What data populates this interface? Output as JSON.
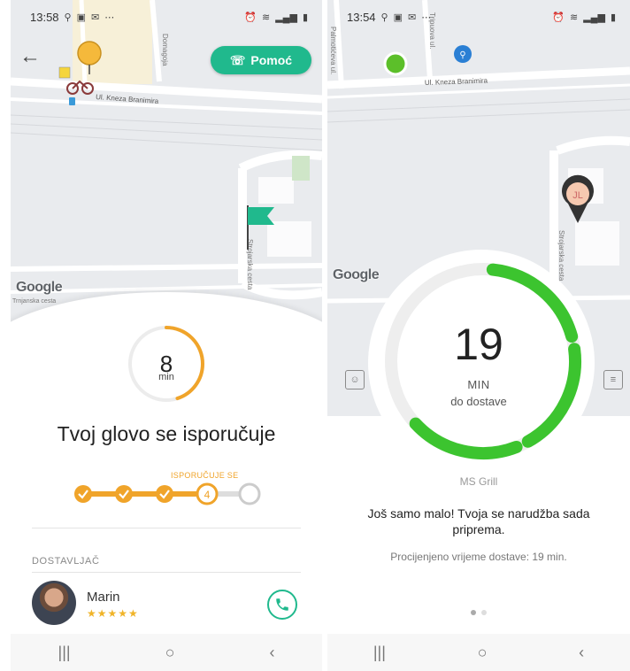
{
  "left_screen": {
    "status_bar": {
      "time": "13:58",
      "icons_left": [
        "location-icon",
        "image-icon",
        "mail-icon",
        "more-icon"
      ],
      "icons_right": [
        "alarm-icon",
        "wifi-icon",
        "call-icon",
        "signal-icon",
        "battery-icon"
      ]
    },
    "map": {
      "streets": [
        "Ul. Kneza Branimira",
        "Domagoja",
        "Strojarska cesta",
        "Trnjanska cesta"
      ],
      "google": "Google"
    },
    "help_button": {
      "label": "Pomoć",
      "icon": "chat-phone-icon"
    },
    "timer": {
      "value": "8",
      "unit": "min",
      "progress": 0.45,
      "color": "#f0a42a"
    },
    "status_title": "Tvoj glovo se isporučuje",
    "progress_steps": {
      "current_label": "ISPORUČUJE SE",
      "current_step": "4",
      "completed": 3,
      "total": 5
    },
    "courier_section": {
      "label": "DOSTAVLJAČ",
      "name": "Marin",
      "rating": "★★★★★"
    },
    "colors": {
      "accent": "#f0a42a",
      "brand": "#20b98d"
    }
  },
  "right_screen": {
    "status_bar": {
      "time": "13:54",
      "icons_left": [
        "location-icon",
        "image-icon",
        "mail-icon",
        "more-icon"
      ],
      "icons_right": [
        "alarm-icon",
        "wifi-icon",
        "call-icon",
        "signal-icon",
        "battery-icon"
      ]
    },
    "map": {
      "streets": [
        "Palmotićeva ul.",
        "Tripuova ul.",
        "Ul. Kneza Branimira",
        "Strojarska cesta"
      ],
      "pin_initials": "JL",
      "google": "Google"
    },
    "countdown": {
      "value": "19",
      "unit": "MIN",
      "subtitle": "do dostave",
      "progress": 0.42,
      "color": "#3cc42f"
    },
    "restaurant": "MS Grill",
    "message": "Još samo malo! Tvoja se narudžba sada priprema.",
    "estimate": "Procijenjeno vrijeme dostave: 19 min.",
    "page_dots": {
      "count": 2,
      "active": 0
    }
  },
  "navbar": {
    "recent": "|||",
    "home": "○",
    "back": "‹"
  }
}
